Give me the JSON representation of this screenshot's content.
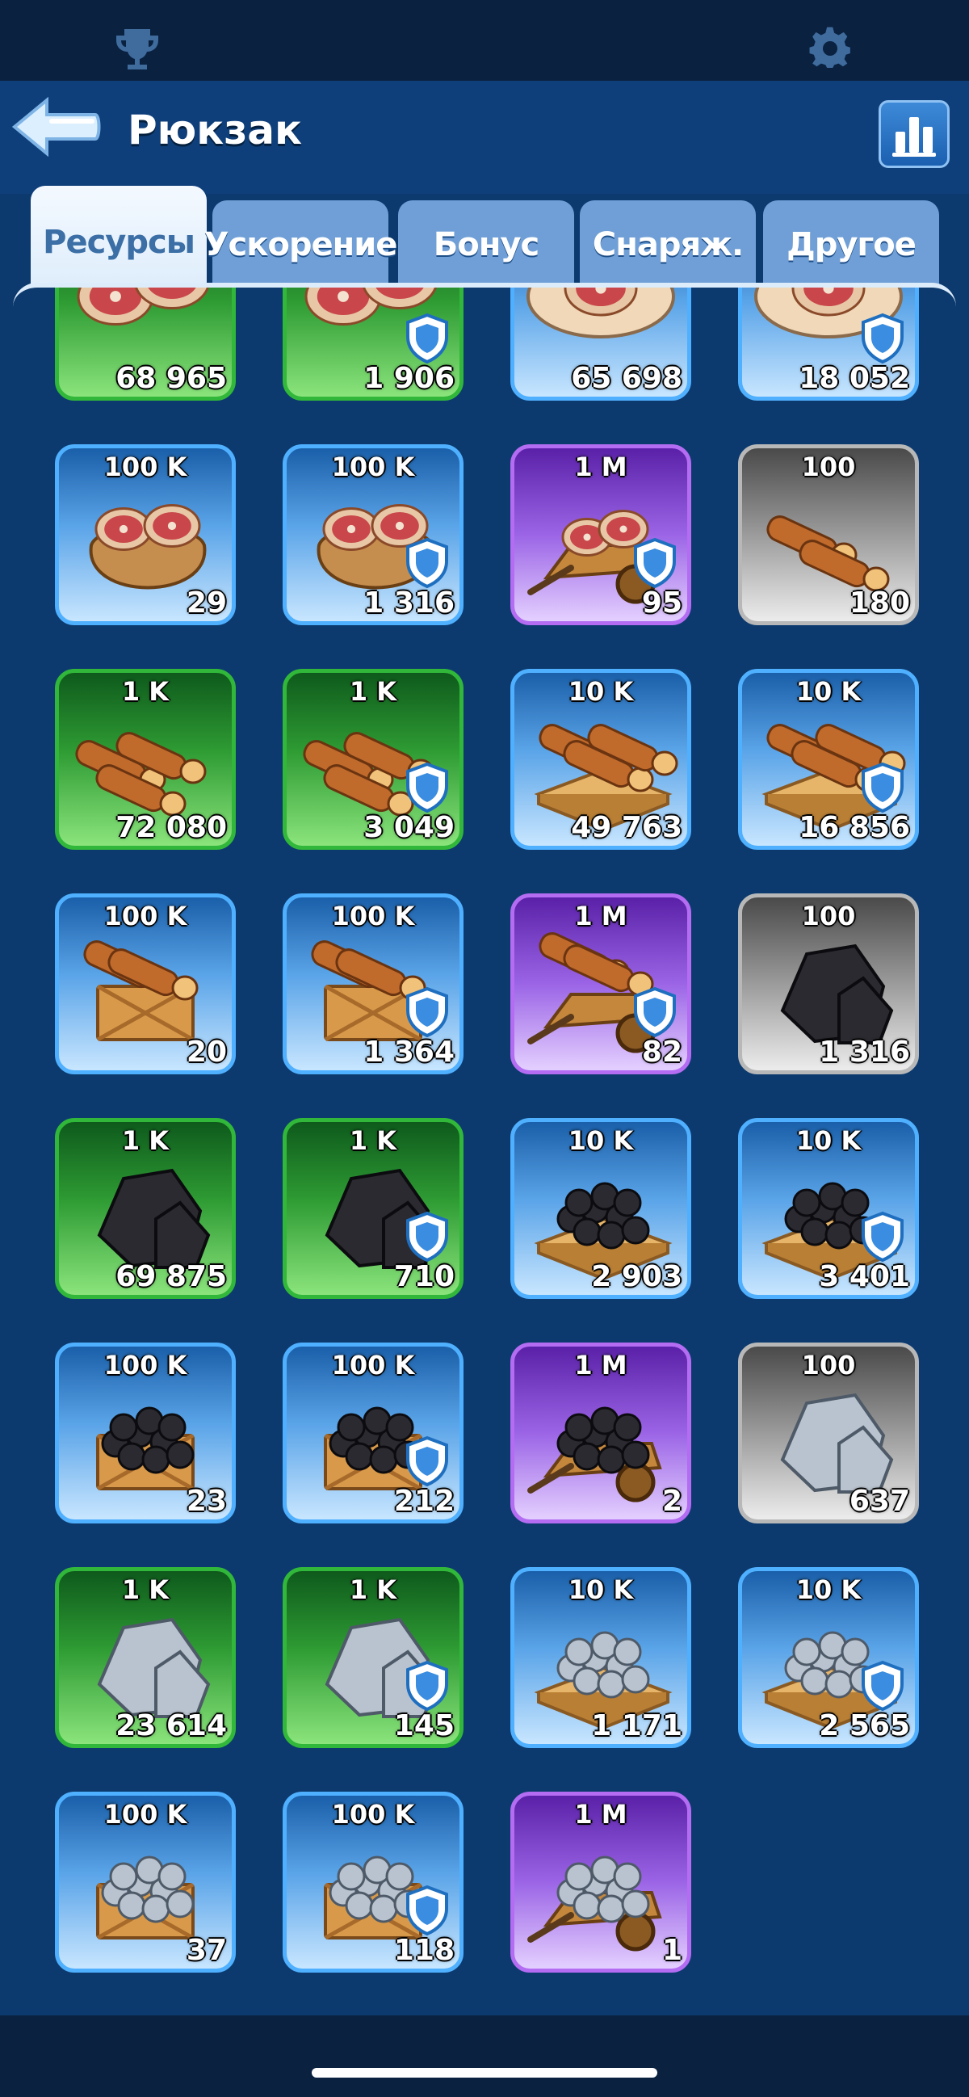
{
  "header": {
    "title": "Рюкзак"
  },
  "top_icons": [
    "trophy-icon",
    "gear-icon"
  ],
  "tabs": [
    {
      "label": "Ресурсы",
      "active": true
    },
    {
      "label": "Ускорение",
      "active": false
    },
    {
      "label": "Бонус",
      "active": false
    },
    {
      "label": "Снаряж.",
      "active": false
    },
    {
      "label": "Другое",
      "active": false
    }
  ],
  "colors": {
    "background": "#0c3a6e",
    "top_bar": "#0a2140",
    "green": "#31b73a",
    "blue": "#4fb0ff",
    "purple": "#b36cf2",
    "gray": "#b8b8b8"
  },
  "items": [
    {
      "denom": "",
      "count": "68 965",
      "rarity": "green",
      "icon": "meat-icon",
      "shield": false
    },
    {
      "denom": "",
      "count": "1 906",
      "rarity": "green",
      "icon": "meat-icon",
      "shield": true
    },
    {
      "denom": "",
      "count": "65 698",
      "rarity": "blue",
      "icon": "meat-platter-icon",
      "shield": false
    },
    {
      "denom": "",
      "count": "18 052",
      "rarity": "blue",
      "icon": "meat-platter-icon",
      "shield": true
    },
    {
      "denom": "100 K",
      "count": "29",
      "rarity": "blue",
      "icon": "meat-sack-icon",
      "shield": false
    },
    {
      "denom": "100 K",
      "count": "1 316",
      "rarity": "blue",
      "icon": "meat-sack-icon",
      "shield": true
    },
    {
      "denom": "1 M",
      "count": "95",
      "rarity": "purple",
      "icon": "meat-cart-icon",
      "shield": true
    },
    {
      "denom": "100",
      "count": "180",
      "rarity": "gray",
      "icon": "wood-icon",
      "shield": false
    },
    {
      "denom": "1 K",
      "count": "72 080",
      "rarity": "green",
      "icon": "log-pile-icon",
      "shield": false
    },
    {
      "denom": "1 K",
      "count": "3 049",
      "rarity": "green",
      "icon": "log-pile-icon",
      "shield": true
    },
    {
      "denom": "10 K",
      "count": "49 763",
      "rarity": "blue",
      "icon": "log-pallet-icon",
      "shield": false
    },
    {
      "denom": "10 K",
      "count": "16 856",
      "rarity": "blue",
      "icon": "log-pallet-icon",
      "shield": true
    },
    {
      "denom": "100 K",
      "count": "20",
      "rarity": "blue",
      "icon": "wood-crate-icon",
      "shield": false
    },
    {
      "denom": "100 K",
      "count": "1 364",
      "rarity": "blue",
      "icon": "wood-crate-icon",
      "shield": true
    },
    {
      "denom": "1 M",
      "count": "82",
      "rarity": "purple",
      "icon": "wood-cart-icon",
      "shield": true
    },
    {
      "denom": "100",
      "count": "1 316",
      "rarity": "gray",
      "icon": "coal-icon",
      "shield": false
    },
    {
      "denom": "1 K",
      "count": "69 875",
      "rarity": "green",
      "icon": "coal-pile-icon",
      "shield": false
    },
    {
      "denom": "1 K",
      "count": "710",
      "rarity": "green",
      "icon": "coal-pile-icon",
      "shield": true
    },
    {
      "denom": "10 K",
      "count": "2 903",
      "rarity": "blue",
      "icon": "coal-pallet-icon",
      "shield": false
    },
    {
      "denom": "10 K",
      "count": "3 401",
      "rarity": "blue",
      "icon": "coal-pallet-icon",
      "shield": true
    },
    {
      "denom": "100 K",
      "count": "23",
      "rarity": "blue",
      "icon": "coal-crate-icon",
      "shield": false
    },
    {
      "denom": "100 K",
      "count": "212",
      "rarity": "blue",
      "icon": "coal-crate-icon",
      "shield": true
    },
    {
      "denom": "1 M",
      "count": "2",
      "rarity": "purple",
      "icon": "coal-cart-icon",
      "shield": false
    },
    {
      "denom": "100",
      "count": "637",
      "rarity": "gray",
      "icon": "iron-icon",
      "shield": false
    },
    {
      "denom": "1 K",
      "count": "23 614",
      "rarity": "green",
      "icon": "iron-pile-icon",
      "shield": false
    },
    {
      "denom": "1 K",
      "count": "145",
      "rarity": "green",
      "icon": "iron-pile-icon",
      "shield": true
    },
    {
      "denom": "10 K",
      "count": "1 171",
      "rarity": "blue",
      "icon": "iron-pallet-icon",
      "shield": false
    },
    {
      "denom": "10 K",
      "count": "2 565",
      "rarity": "blue",
      "icon": "iron-pallet-icon",
      "shield": true
    },
    {
      "denom": "100 K",
      "count": "37",
      "rarity": "blue",
      "icon": "iron-crate-icon",
      "shield": false
    },
    {
      "denom": "100 K",
      "count": "118",
      "rarity": "blue",
      "icon": "iron-crate-icon",
      "shield": true
    },
    {
      "denom": "1 M",
      "count": "1",
      "rarity": "purple",
      "icon": "iron-cart-icon",
      "shield": false
    }
  ]
}
